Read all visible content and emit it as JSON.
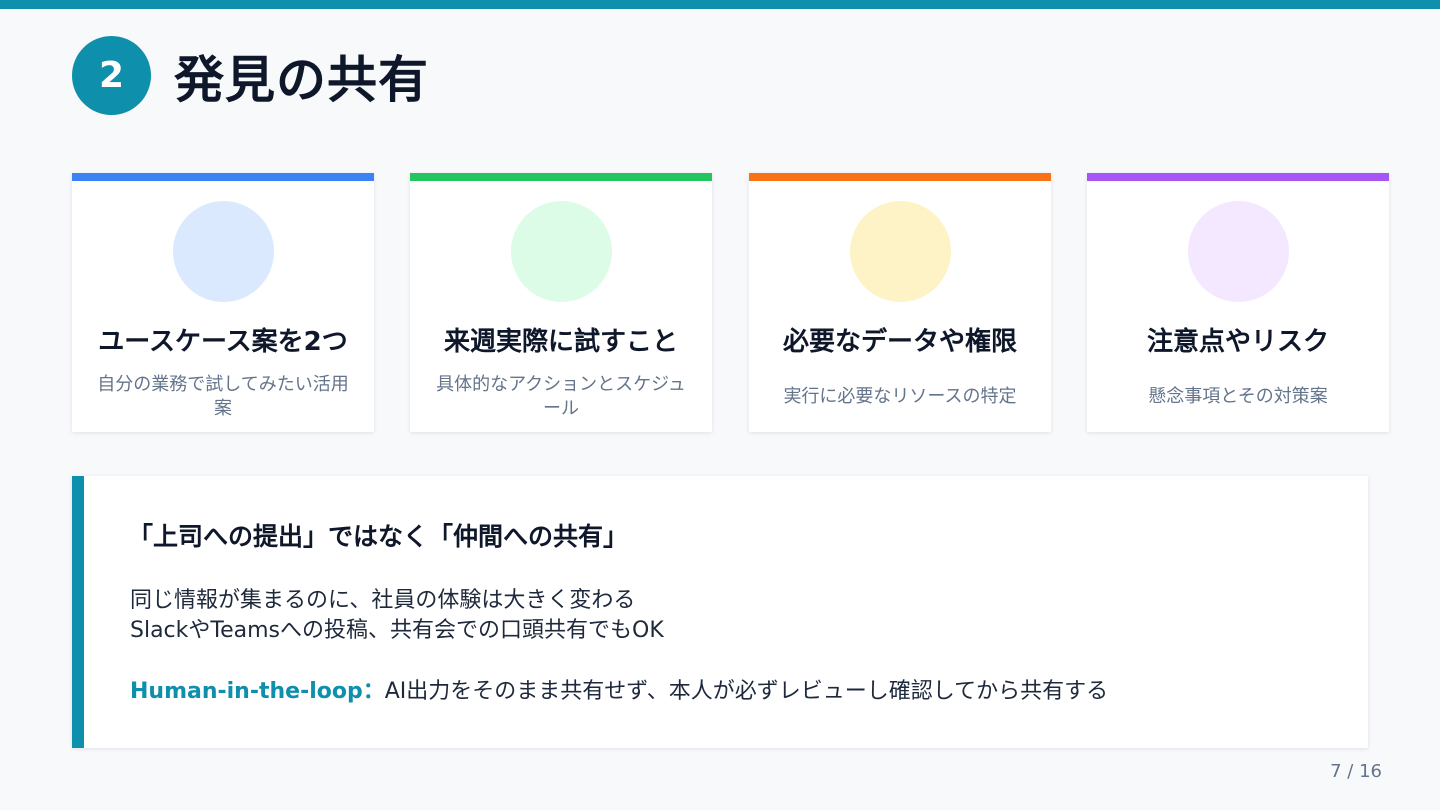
{
  "colors": {
    "accent": "#0e8fab",
    "blue": "#3b82f6",
    "green": "#22c55e",
    "orange": "#f97316",
    "purple": "#a855f7"
  },
  "header": {
    "section_number": "2",
    "title": "発見の共有"
  },
  "cards": [
    {
      "title": "ユースケース案を2つ",
      "description": "自分の業務で試してみたい活用案",
      "stripe_color": "#3b82f6",
      "circle_color": "#dbe9fe"
    },
    {
      "title": "来週実際に試すこと",
      "description": "具体的なアクションとスケジュール",
      "stripe_color": "#22c55e",
      "circle_color": "#dcfce7"
    },
    {
      "title": "必要なデータや権限",
      "description": "実行に必要なリソースの特定",
      "stripe_color": "#f97316",
      "circle_color": "#fef3c7"
    },
    {
      "title": "注意点やリスク",
      "description": "懸念事項とその対策案",
      "stripe_color": "#a855f7",
      "circle_color": "#f3e8ff"
    }
  ],
  "note": {
    "heading": "「上司への提出」ではなく「仲間への共有」",
    "line1": "同じ情報が集まるのに、社員の体験は大きく変わる",
    "line2": "SlackやTeamsへの投稿、共有会での口頭共有でもOK",
    "hitl_label": "Human-in-the-loop：",
    "hitl_text": "AI出力をそのまま共有せず、本人が必ずレビューし確認してから共有する"
  },
  "footer": {
    "page": "7 / 16"
  }
}
